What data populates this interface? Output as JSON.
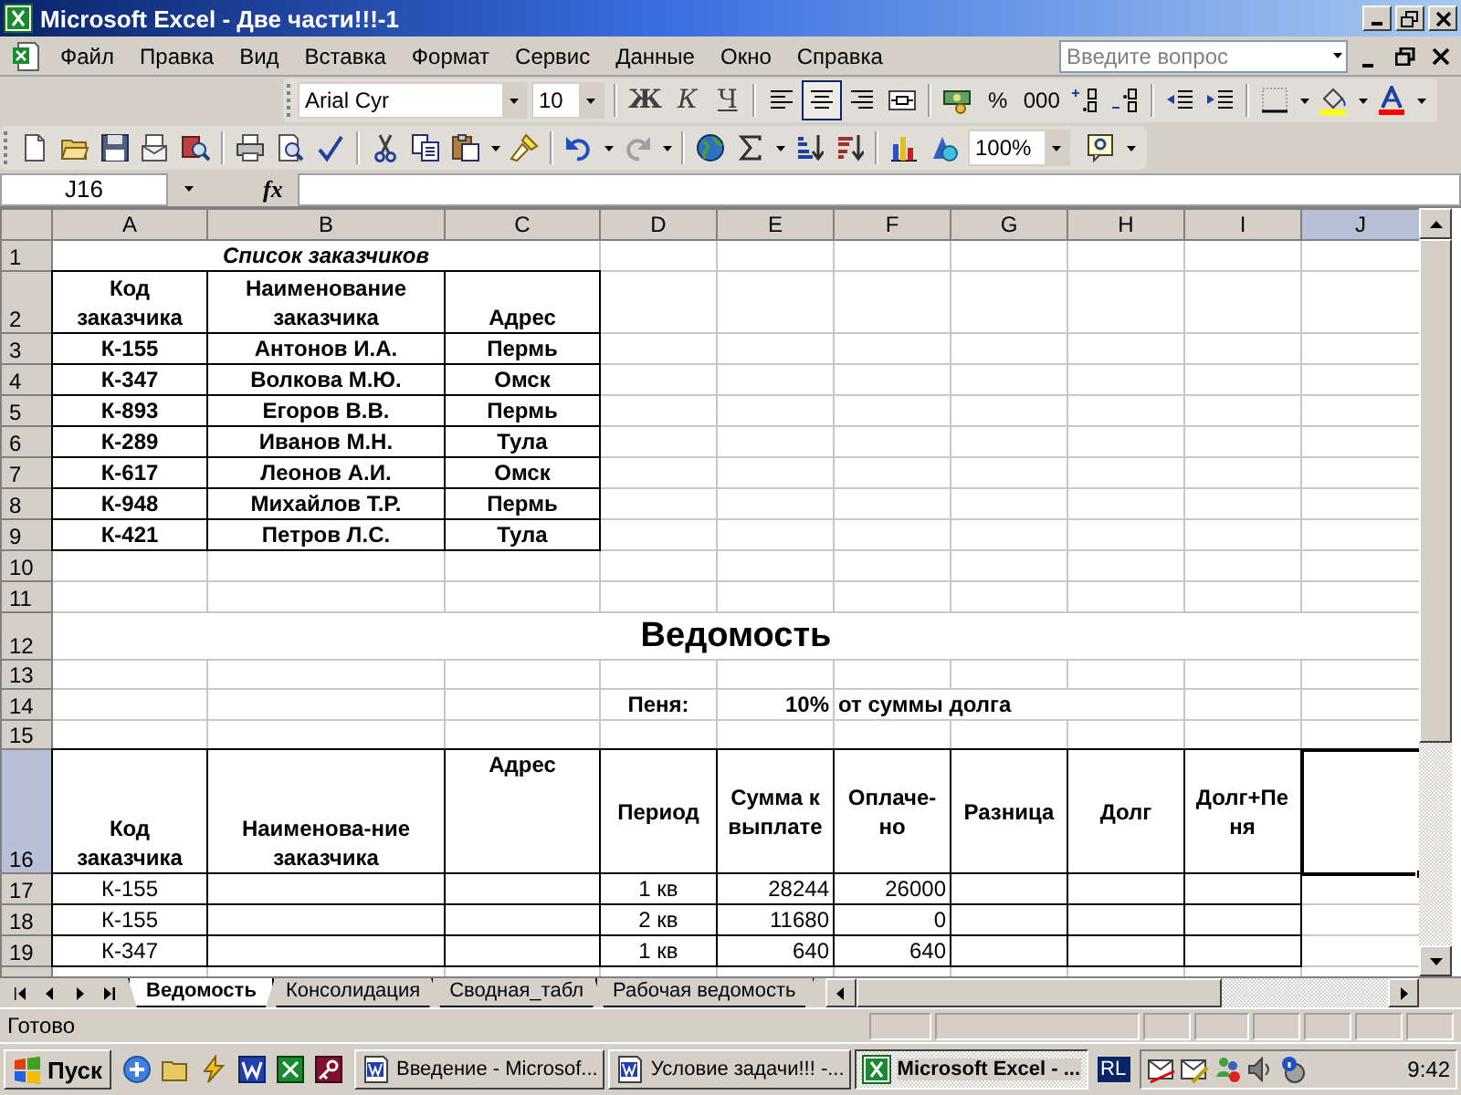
{
  "window": {
    "title": "Microsoft Excel - Две части!!!-1"
  },
  "menu": {
    "items": [
      "Файл",
      "Правка",
      "Вид",
      "Вставка",
      "Формат",
      "Сервис",
      "Данные",
      "Окно",
      "Справка"
    ],
    "search": {
      "placeholder": "Введите вопрос"
    }
  },
  "formatting_toolbar": {
    "font": "Arial Cyr",
    "size": "10",
    "style_buttons": [
      "Ж",
      "К",
      "Ч"
    ],
    "alignment": [
      {
        "selected": false
      },
      {
        "selected": true
      },
      {
        "selected": false
      }
    ],
    "number_buttons": [
      "%",
      "000"
    ]
  },
  "standard_toolbar": {
    "zoom": "100%"
  },
  "formula_bar": {
    "name_box": "J16",
    "function_label": "fx"
  },
  "sheet": {
    "columns": [
      {
        "label": "A",
        "selected": false
      },
      {
        "label": "B",
        "selected": false
      },
      {
        "label": "C",
        "selected": false
      },
      {
        "label": "D",
        "selected": false
      },
      {
        "label": "E",
        "selected": false
      },
      {
        "label": "F",
        "selected": false
      },
      {
        "label": "G",
        "selected": false
      },
      {
        "label": "H",
        "selected": false
      },
      {
        "label": "I",
        "selected": false
      },
      {
        "label": "J",
        "selected": true
      }
    ],
    "rows": [
      {
        "label": "1",
        "selected": false,
        "kind": "title",
        "cells": [
          "Список заказчиков"
        ]
      },
      {
        "label": "2",
        "selected": false,
        "kind": "list",
        "cells": [
          "Код заказчика",
          "Наименование заказчика",
          "Адрес"
        ]
      },
      {
        "label": "3",
        "selected": false,
        "kind": "list",
        "cells": [
          "К-155",
          "Антонов И.А.",
          "Пермь"
        ]
      },
      {
        "label": "4",
        "selected": false,
        "kind": "list",
        "cells": [
          "К-347",
          "Волкова М.Ю.",
          "Омск"
        ]
      },
      {
        "label": "5",
        "selected": false,
        "kind": "list",
        "cells": [
          "К-893",
          "Егоров В.В.",
          "Пермь"
        ]
      },
      {
        "label": "6",
        "selected": false,
        "kind": "list",
        "cells": [
          "К-289",
          "Иванов М.Н.",
          "Тула"
        ]
      },
      {
        "label": "7",
        "selected": false,
        "kind": "list",
        "cells": [
          "К-617",
          "Леонов А.И.",
          "Омск"
        ]
      },
      {
        "label": "8",
        "selected": false,
        "kind": "list",
        "cells": [
          "К-948",
          "Михайлов Т.Р.",
          "Пермь"
        ]
      },
      {
        "label": "9",
        "selected": false,
        "kind": "list",
        "cells": [
          "К-421",
          "Петров Л.С.",
          "Тула"
        ]
      },
      {
        "label": "10",
        "selected": false,
        "kind": "blank"
      },
      {
        "label": "11",
        "selected": false,
        "kind": "blank"
      },
      {
        "label": "12",
        "selected": false,
        "kind": "heading",
        "cells": [
          "Ведомость"
        ]
      },
      {
        "label": "13",
        "selected": false,
        "kind": "blank"
      },
      {
        "label": "14",
        "selected": false,
        "kind": "penalty",
        "cells": [
          "Пеня:",
          "10%",
          "от суммы долга"
        ]
      },
      {
        "label": "15",
        "selected": false,
        "kind": "blank"
      },
      {
        "label": "16",
        "selected": true,
        "kind": "table-head",
        "cells": [
          "Код заказчика",
          "Наименова-ние заказчика",
          "Адрес",
          "Период",
          "Сумма к выплате",
          "Оплаче-но",
          "Разница",
          "Долг",
          "Долг+Пе ня"
        ]
      },
      {
        "label": "17",
        "selected": false,
        "kind": "entry",
        "cells": [
          "К-155",
          "1 кв",
          "28244",
          "26000"
        ]
      },
      {
        "label": "18",
        "selected": false,
        "kind": "entry",
        "cells": [
          "К-155",
          "2 кв",
          "11680",
          "0"
        ]
      },
      {
        "label": "19",
        "selected": false,
        "kind": "entry",
        "cells": [
          "К-347",
          "1 кв",
          "640",
          "640"
        ]
      }
    ]
  },
  "sheet_tabs": [
    {
      "label": "Ведомость",
      "selected": true
    },
    {
      "label": "Консолидация",
      "selected": false
    },
    {
      "label": "Сводная_табл",
      "selected": false
    },
    {
      "label": "Рабочая ведомость",
      "selected": false
    }
  ],
  "status_bar": {
    "text": "Готово"
  },
  "taskbar": {
    "start": "Пуск",
    "tasks": [
      {
        "label": "Введение - Microsof...",
        "selected": false
      },
      {
        "label": "Условие задачи!!! -...",
        "selected": false
      },
      {
        "label": "Microsoft Excel - ...",
        "selected": true
      }
    ],
    "language": "RL",
    "clock": "9:42"
  }
}
